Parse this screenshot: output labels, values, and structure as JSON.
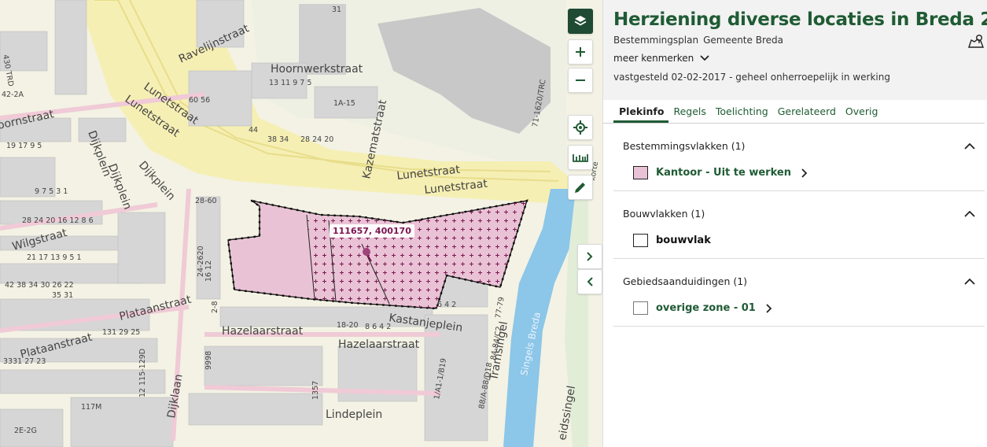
{
  "map": {
    "coordinate_readout": "111657, 400170",
    "street_labels": {
      "lunetstraat_1": "Lunetstraat",
      "lunetstraat_2": "Lunetstraat",
      "lunetstraat_3": "Lunetstraat",
      "lunetstraat_4": "Lunetstraat",
      "hoornwerkstraat": "Hoornwerkstraat",
      "ravelijnstraat": "Ravelijnstraat",
      "kazematstraat": "Kazematstraat",
      "dijkplein_1": "Dijkplein",
      "dijkplein_2": "Dijkplein",
      "dijkplein_3": "Dijkplein",
      "wilgstraat": "Wilgstraat",
      "plataanstraat_1": "Plataanstraat",
      "plataanstraat_2": "Plataanstraat",
      "hazelaarstraat_1": "Hazelaarstraat",
      "hazelaarstraat_2": "Hazelaarstraat",
      "kastanjeplein": "Kastanjeplein",
      "lindeplein": "Lindeplein",
      "dijklaan": "Dijklaan",
      "tramsingel": "Tramsingel",
      "singels_breda": "Singels Breda",
      "hoornstraat": "oornstraat",
      "leidssingel": "eidssingel",
      "corner_b": "korte"
    },
    "house_numbers": {
      "n31": "31",
      "n13_11": "13 11 9 7 5",
      "n1a15": "1A-15",
      "n44": "44",
      "n38": "38 34",
      "n28": "28 24 20",
      "n60": "60 56",
      "n28_60": "28-60",
      "n24_26": "24-2620",
      "n12": "16 12",
      "n2_8": "2-8",
      "n4_2": "6 4 2",
      "n18_20": "18-20",
      "n8_2": "8 6 4 2",
      "n28_2": "28 24 20 16 12 8 6",
      "n9_1": "9 7 5 3 1",
      "n4_2A": "42-2A",
      "n430": "430 TRD",
      "n17_9": "19 17 9 5",
      "n21_17": "21 17 13 9 5 1",
      "n42_8": "42 38 34 30 26 22",
      "n71": "71-1620/TRC",
      "n7": "77-79",
      "n84": "84-84/C2",
      "n88": "88/A-88/D18",
      "n1": "1/A1-1/B19",
      "n117": "117M",
      "n2e": "2E-2G",
      "n3331": "3331 27 23",
      "n131": "131 29 25",
      "n2113": "12 115-129D",
      "n9998": "9998",
      "n1357": "1357",
      "n35": "35 31"
    }
  },
  "controls": {
    "layers": "layers-icon",
    "zoom_in": "plus-icon",
    "zoom_out": "minus-icon",
    "locate": "crosshair-icon",
    "measure": "ruler-icon",
    "draw": "pencil-icon",
    "next": "chevron-right-icon",
    "prev": "chevron-left-icon"
  },
  "panel": {
    "title": "Herziening diverse locaties in Breda 2016",
    "plan_type": "Bestemmingsplan",
    "authority": "Gemeente Breda",
    "more_label": "meer kenmerken",
    "status": "vastgesteld 02-02-2017 - geheel onherroepelijk in werking",
    "tabs": [
      {
        "label": "Plekinfo",
        "active": true
      },
      {
        "label": "Regels"
      },
      {
        "label": "Toelichting"
      },
      {
        "label": "Gerelateerd"
      },
      {
        "label": "Overig"
      }
    ],
    "sections": [
      {
        "heading": "Bestemmingsvlakken (1)",
        "item": "Kantoor - Uit te werken",
        "swatch_color": "#e9c3d5",
        "link": true
      },
      {
        "heading": "Bouwvlakken (1)",
        "item": "bouwvlak",
        "swatch_color": "#ffffff",
        "link": false
      },
      {
        "heading": "Gebiedsaanduidingen (1)",
        "item": "overige zone - 01",
        "swatch_color": "#ffffff",
        "link": true
      }
    ]
  },
  "colors": {
    "brand_green": "#1f5b34",
    "plan_fill": "#e9c3d5",
    "water": "#8cc6e8",
    "road_yellow": "#f6efb4"
  }
}
